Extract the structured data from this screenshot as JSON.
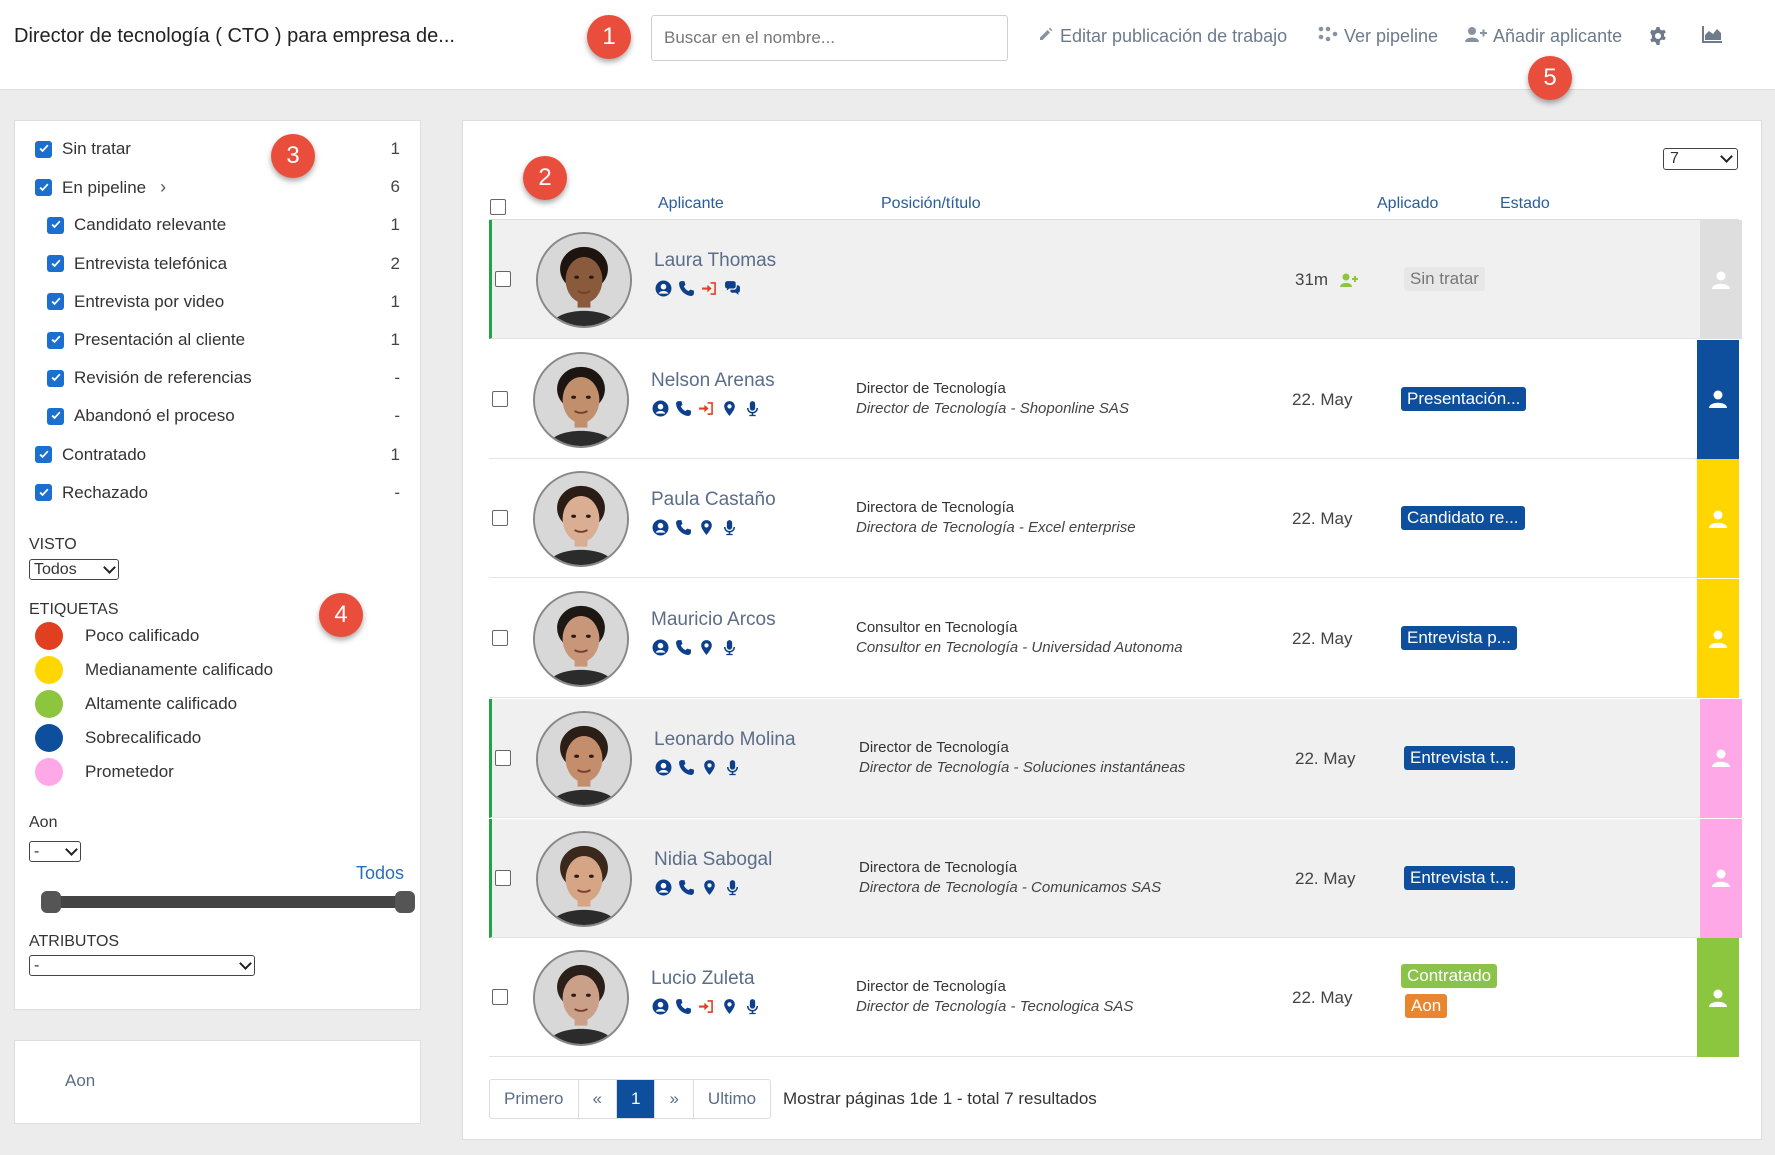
{
  "header": {
    "job_title": "Director de tecnología ( CTO ) para empresa de...",
    "search_placeholder": "Buscar en el nombre...",
    "edit_job": "Editar publicación de trabajo",
    "view_pipeline": "Ver pipeline",
    "add_applicant": "Añadir aplicante",
    "settings_icon": "gear-icon",
    "stats_icon": "chart-icon"
  },
  "markers": [
    "1",
    "2",
    "3",
    "4",
    "5"
  ],
  "filters": {
    "statuses": [
      {
        "label": "Sin tratar",
        "count": "1",
        "checked": true
      },
      {
        "label": "En pipeline",
        "count": "6",
        "checked": true
      },
      {
        "label": "Candidato relevante",
        "count": "1",
        "checked": true
      },
      {
        "label": "Entrevista telefónica",
        "count": "2",
        "checked": true
      },
      {
        "label": "Entrevista por video",
        "count": "1",
        "checked": true
      },
      {
        "label": "Presentación al cliente",
        "count": "1",
        "checked": true
      },
      {
        "label": "Revisión de referencias",
        "count": "-",
        "checked": true
      },
      {
        "label": "Abandonó el proceso",
        "count": "-",
        "checked": true
      },
      {
        "label": "Contratado",
        "count": "1",
        "checked": true
      },
      {
        "label": "Rechazado",
        "count": "-",
        "checked": true
      }
    ],
    "visto_label": "VISTO",
    "visto_value": "Todos",
    "etiquetas_label": "ETIQUETAS",
    "tags": [
      {
        "label": "Poco calificado",
        "color": "#e0401f"
      },
      {
        "label": "Medianamente calificado",
        "color": "#ffd600"
      },
      {
        "label": "Altamente calificado",
        "color": "#8cc63f"
      },
      {
        "label": "Sobrecalificado",
        "color": "#0d4f9c"
      },
      {
        "label": "Prometedor",
        "color": "#ffa8e8"
      }
    ],
    "aon_label": "Aon",
    "aon_value": "-",
    "todos_link": "Todos",
    "slider_range": [
      0,
      100
    ],
    "atributos_label": "ATRIBUTOS",
    "atributos_value": "-"
  },
  "footer_panel": {
    "text": "Aon"
  },
  "table": {
    "per_page": "7",
    "headers": {
      "applicant": "Aplicante",
      "position": "Posición/título",
      "applied": "Aplicado",
      "status": "Estado"
    },
    "rows": [
      {
        "name": "Laura Thomas",
        "pos1": "",
        "pos2": "",
        "applied": "31m",
        "badge": "Sin tratar",
        "badge_color": "grey",
        "badge2": "",
        "side_color": "#dedede",
        "icons": [
          "profile",
          "phone",
          "signin",
          "chat"
        ],
        "shaded": true,
        "greenedge": true,
        "skin": "#8a5a3c",
        "hair": "#1d1410"
      },
      {
        "name": "Nelson Arenas",
        "pos1": "Director de Tecnología",
        "pos2": "Director de Tecnología - Shoponline SAS",
        "applied": "22. May",
        "badge": "Presentación...",
        "badge_color": "blue",
        "badge2": "",
        "side_color": "#0d4f9c",
        "icons": [
          "profile",
          "phone",
          "signin",
          "location",
          "mic"
        ],
        "shaded": false,
        "greenedge": false,
        "skin": "#c28f6c",
        "hair": "#1c1511"
      },
      {
        "name": "Paula Castaño",
        "pos1": "Directora de Tecnología",
        "pos2": "Directora de Tecnología - Excel enterprise",
        "applied": "22. May",
        "badge": "Candidato re...",
        "badge_color": "blue",
        "badge2": "",
        "side_color": "#ffd600",
        "icons": [
          "profile",
          "phone",
          "location",
          "mic"
        ],
        "shaded": false,
        "greenedge": false,
        "skin": "#d9ae92",
        "hair": "#2a1d16"
      },
      {
        "name": "Mauricio Arcos",
        "pos1": "Consultor en Tecnología",
        "pos2": "Consultor en Tecnología - Universidad Autonoma",
        "applied": "22. May",
        "badge": "Entrevista p...",
        "badge_color": "blue",
        "badge2": "",
        "side_color": "#ffd600",
        "icons": [
          "profile",
          "phone",
          "location",
          "mic"
        ],
        "shaded": false,
        "greenedge": false,
        "skin": "#c8977a",
        "hair": "#1e1814"
      },
      {
        "name": "Leonardo Molina",
        "pos1": "Director de Tecnología",
        "pos2": "Director de Tecnología - Soluciones instantáneas",
        "applied": "22. May",
        "badge": "Entrevista t...",
        "badge_color": "blue",
        "badge2": "",
        "side_color": "#ffa8e8",
        "icons": [
          "profile",
          "phone",
          "location",
          "mic"
        ],
        "shaded": true,
        "greenedge": true,
        "skin": "#c48d6c",
        "hair": "#2a1e17"
      },
      {
        "name": "Nidia Sabogal",
        "pos1": "Directora de Tecnología",
        "pos2": "Directora de Tecnología - Comunicamos SAS",
        "applied": "22. May",
        "badge": "Entrevista t...",
        "badge_color": "blue",
        "badge2": "",
        "side_color": "#ffa8e8",
        "icons": [
          "profile",
          "phone",
          "location",
          "mic"
        ],
        "shaded": true,
        "greenedge": true,
        "skin": "#d5a585",
        "hair": "#3a281c"
      },
      {
        "name": "Lucio Zuleta",
        "pos1": "Director de Tecnología",
        "pos2": "Director de Tecnología - Tecnologica SAS",
        "applied": "22. May",
        "badge": "Contratado",
        "badge_color": "green",
        "badge2": "Aon",
        "side_color": "#8cc63f",
        "icons": [
          "profile",
          "phone",
          "signin",
          "location",
          "mic"
        ],
        "shaded": false,
        "greenedge": false,
        "skin": "#caa088",
        "hair": "#2b2019"
      }
    ]
  },
  "pagination": {
    "first": "Primero",
    "prev": "«",
    "current": "1",
    "next": "»",
    "last": "Ultimo",
    "info_prefix": "Mostrar páginas ",
    "page": "1",
    "info_mid": "de ",
    "pages_total": "1",
    "info_sep": " - total ",
    "results": "7",
    "info_suffix": " resultados"
  }
}
